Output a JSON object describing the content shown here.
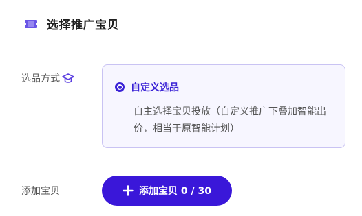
{
  "header": {
    "title": "选择推广宝贝",
    "icon": "ticket-icon"
  },
  "mode": {
    "label": "选品方式",
    "label_icon": "graduation-cap-icon",
    "option": {
      "title": "自定义选品",
      "selected": true,
      "description": "自主选择宝贝投放（自定义推广下叠加智能出价，相当于原智能计划）"
    }
  },
  "add_item": {
    "label": "添加宝贝",
    "button_label": "添加宝贝 0 / 30",
    "button_icon": "plus-icon"
  },
  "colors": {
    "accent": "#3a17d9",
    "card_bg": "#f7f6ff",
    "card_border": "#c9c3f3"
  }
}
